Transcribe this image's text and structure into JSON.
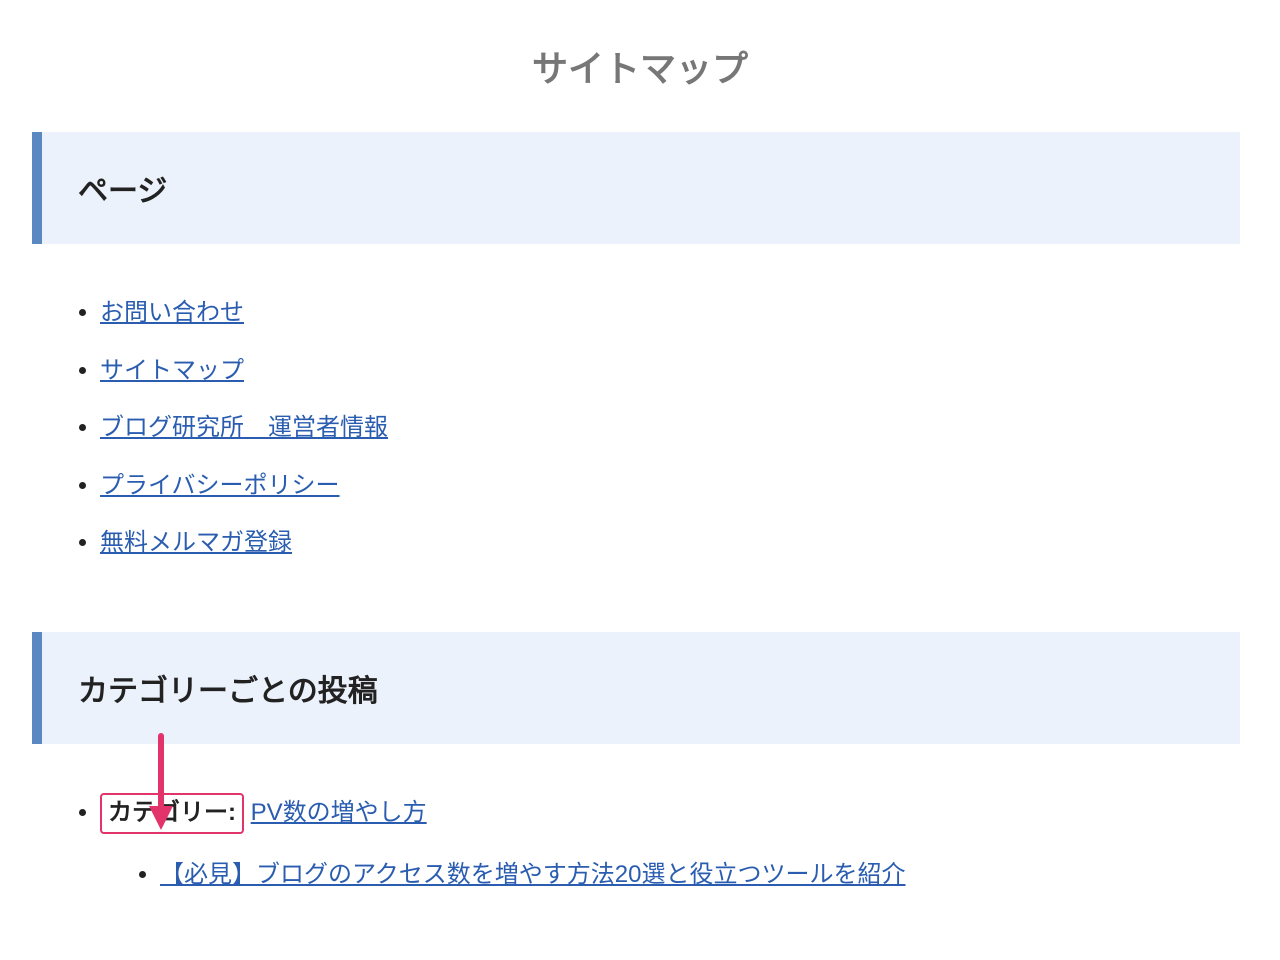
{
  "title": "サイトマップ",
  "section_pages": {
    "heading": "ページ",
    "items": [
      "お問い合わせ",
      "サイトマップ",
      "ブログ研究所　運営者情報",
      "プライバシーポリシー",
      "無料メルマガ登録"
    ]
  },
  "section_posts": {
    "heading": "カテゴリーごとの投稿",
    "category_label": "カテゴリー:",
    "category_name": "PV数の増やし方",
    "posts": [
      "【必見】ブログのアクセス数を増やす方法20選と役立つツールを紹介"
    ]
  },
  "annotation": {
    "arrow_color": "#e2336b"
  }
}
